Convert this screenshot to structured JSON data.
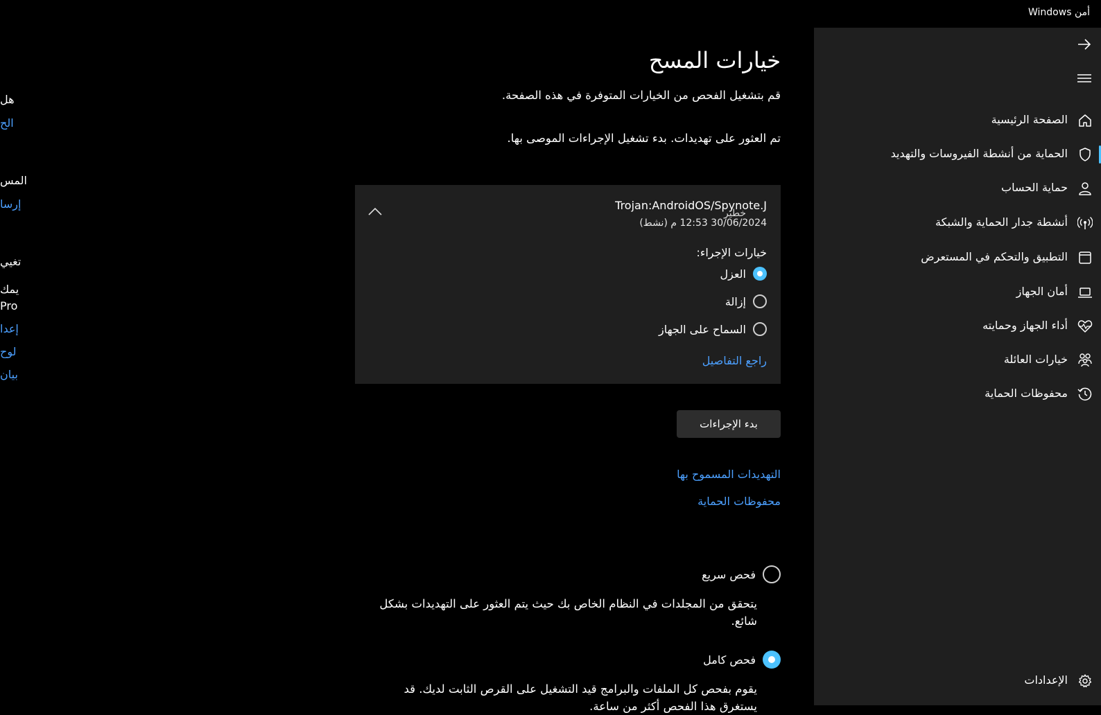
{
  "window": {
    "title": "أمن Windows"
  },
  "sidebar": {
    "items": [
      {
        "label": "الصفحة الرئيسية",
        "icon": "home-icon"
      },
      {
        "label": "الحماية من أنشطة الفيروسات والتهديد",
        "icon": "shield-icon",
        "active": true
      },
      {
        "label": "حماية الحساب",
        "icon": "person-icon"
      },
      {
        "label": "أنشطة جدار الحماية والشبكة",
        "icon": "wifi-antenna-icon"
      },
      {
        "label": "التطبيق والتحكم في المستعرض",
        "icon": "app-window-icon"
      },
      {
        "label": "أمان الجهاز",
        "icon": "laptop-icon"
      },
      {
        "label": "أداء الجهاز وحمايته",
        "icon": "heart-pulse-icon"
      },
      {
        "label": "خيارات العائلة",
        "icon": "family-icon"
      },
      {
        "label": "محفوظات الحماية",
        "icon": "history-icon"
      }
    ],
    "settings_label": "الإعدادات",
    "accent": "#4cc2ff"
  },
  "main": {
    "title": "خيارات المسح",
    "subtitle": "قم بتشغيل الفحص من الخيارات المتوفرة في هذه الصفحة.",
    "threat_message": "تم العثور على تهديدات. بدء تشغيل الإجراءات الموصى بها.",
    "threat": {
      "name": "Trojan:AndroidOS/Spynote.J",
      "date": "30/06/2024 12:53 م (نشط)",
      "severity": "خطير",
      "actions_label": "خيارات الإجراء:",
      "options": [
        {
          "label": "العزل",
          "selected": true
        },
        {
          "label": "إزالة",
          "selected": false
        },
        {
          "label": "السماح على الجهاز",
          "selected": false
        }
      ],
      "details_link": "راجع التفاصيل"
    },
    "start_button": "بدء الإجراءات",
    "links": {
      "allowed_threats": "التهديدات المسموح بها",
      "protection_history": "محفوظات الحماية"
    },
    "scan_options": [
      {
        "label": "فحص سريع",
        "selected": false,
        "description": "يتحقق من المجلدات في النظام الخاص بك حيث يتم العثور على التهديدات بشكل شائع."
      },
      {
        "label": "فحص كامل",
        "selected": true,
        "description": "يقوم بفحص كل الملفات والبرامج قيد التشغيل على القرص الثابت لديك. قد يستغرق هذا الفحص أكثر من ساعة."
      }
    ]
  },
  "left_panel": {
    "lines": [
      "هل",
      "الح",
      "المس",
      "إرسا",
      "تغيي",
      "يمك",
      "Pro",
      "إعدا",
      "لوح",
      "بيان"
    ]
  }
}
